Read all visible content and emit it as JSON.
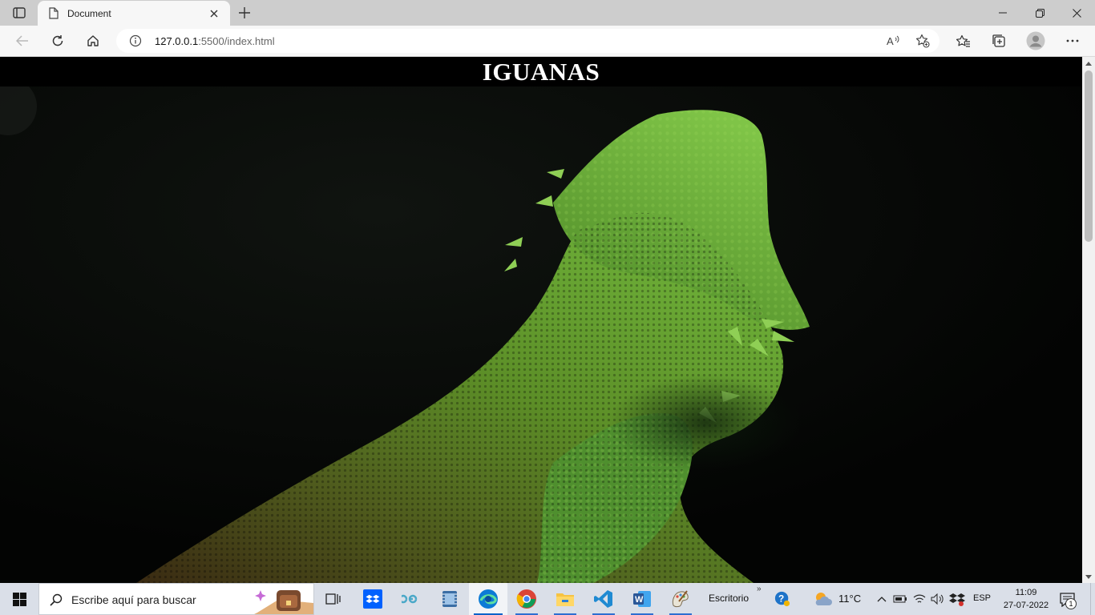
{
  "browser": {
    "tab": {
      "title": "Document",
      "favicon": "document-icon"
    },
    "address": {
      "host": "127.0.0.1",
      "rest": ":5500/index.html"
    },
    "icons": {
      "tab_actions": "tab-actions-icon",
      "new_tab": "plus-icon",
      "minimize": "minimize-icon",
      "restore": "restore-icon",
      "close": "close-icon",
      "back": "back-arrow-icon",
      "refresh": "refresh-icon",
      "home": "home-icon",
      "site_info": "info-icon",
      "read_aloud": "read-aloud-icon",
      "add_favorite": "add-favorite-icon",
      "favorites": "favorites-icon",
      "collections": "collections-icon",
      "profile": "profile-icon",
      "more": "more-icon"
    }
  },
  "page": {
    "title": "IGUANAS",
    "hero_alt": "green bearded dragon lizard on dark background"
  },
  "taskbar": {
    "search_placeholder": "Escribe aquí para buscar",
    "apps": [
      "task-view-icon",
      "dropbox-icon",
      "app-icon",
      "video-icon",
      "edge-icon",
      "chrome-icon",
      "file-explorer-icon",
      "vscode-icon",
      "word-icon",
      "paint-icon"
    ],
    "desktop_label": "Escritorio",
    "temperature": "11°C",
    "language": "ESP",
    "time": "11:09",
    "date": "27-07-2022",
    "notification_count": "1",
    "colors": {
      "edge": "#0c7bd6",
      "vscode": "#1f8ad2",
      "word": "#2b5797",
      "dropbox": "#0061fe"
    }
  }
}
